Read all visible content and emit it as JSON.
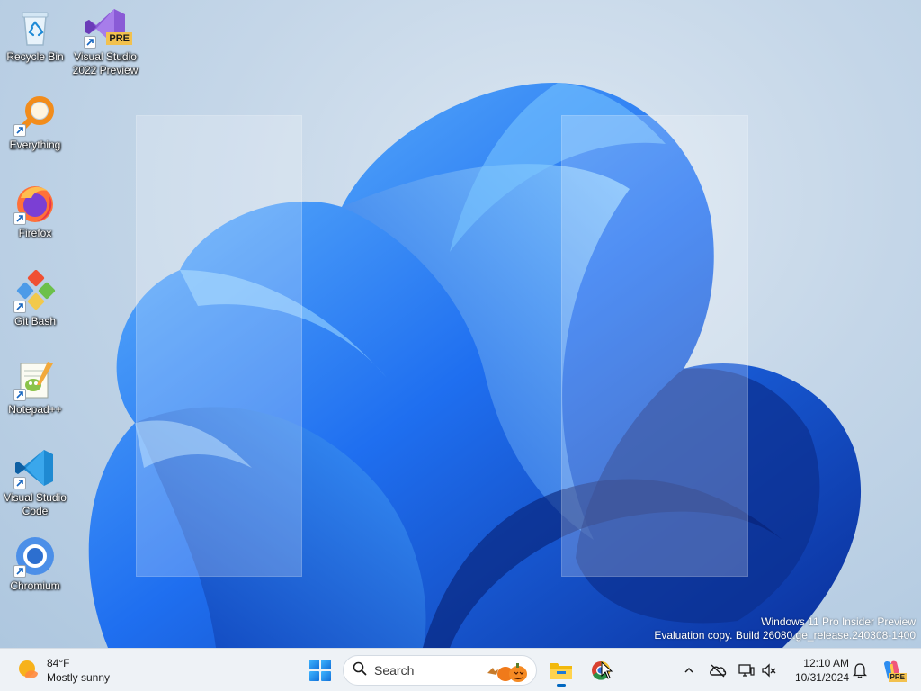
{
  "desktop": {
    "icons": [
      {
        "label": "Recycle Bin",
        "icon": "recycle-bin-icon"
      },
      {
        "label": "Visual Studio 2022 Preview",
        "icon": "visual-studio-preview-icon",
        "badge": "PRE"
      },
      {
        "label": "Everything",
        "icon": "everything-search-icon"
      },
      {
        "label": "Firefox",
        "icon": "firefox-icon"
      },
      {
        "label": "Git Bash",
        "icon": "git-bash-icon"
      },
      {
        "label": "Notepad++",
        "icon": "notepad-plus-plus-icon"
      },
      {
        "label": "Visual Studio Code",
        "icon": "vscode-icon"
      },
      {
        "label": "Chromium",
        "icon": "chromium-icon"
      }
    ],
    "watermark": {
      "line1": "Windows 11 Pro Insider Preview",
      "line2": "Evaluation copy. Build 26080.ge_release.240308-1400"
    },
    "colors": {
      "bloom_dark": "#0a3fb8",
      "bloom_mid": "#1f6ff0",
      "bloom_light": "#5fb0ff"
    }
  },
  "taskbar": {
    "weather": {
      "temp": "84°F",
      "condition": "Mostly sunny",
      "icon": "sun-icon"
    },
    "start_icon": "windows-logo-icon",
    "search": {
      "placeholder": "Search",
      "icon": "search-icon"
    },
    "apps": [
      {
        "name": "File Explorer",
        "icon": "folder-icon",
        "active": true
      },
      {
        "name": "Chromium",
        "icon": "chromium-app-icon",
        "active": false
      }
    ],
    "tray": {
      "icons": [
        "chevron-up-icon",
        "onedrive-offline-icon",
        "network-icon",
        "volume-muted-icon",
        "bell-icon",
        "copilot-pre-icon"
      ],
      "copilot_badge": "PRE"
    },
    "clock": {
      "time": "12:10 AM",
      "date": "10/31/2024"
    }
  }
}
